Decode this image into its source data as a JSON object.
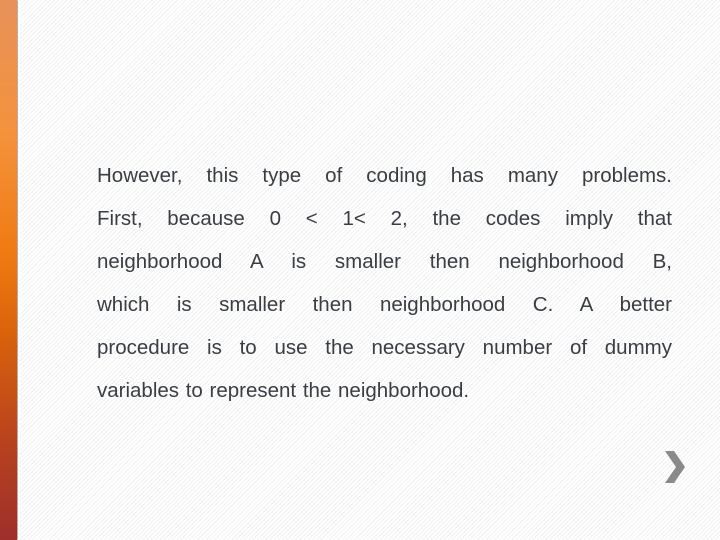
{
  "slide": {
    "body_lines": [
      "However, this type of coding has many problems.",
      "First, because 0 < 1< 2, the codes imply that",
      "neighborhood A is smaller then neighborhood B,",
      "which is smaller then neighborhood C. A better",
      "procedure is to use the necessary number of dummy",
      "variables to represent the neighborhood."
    ],
    "accent_color": "#f07a12",
    "next_icon": "chevron-right-icon"
  }
}
